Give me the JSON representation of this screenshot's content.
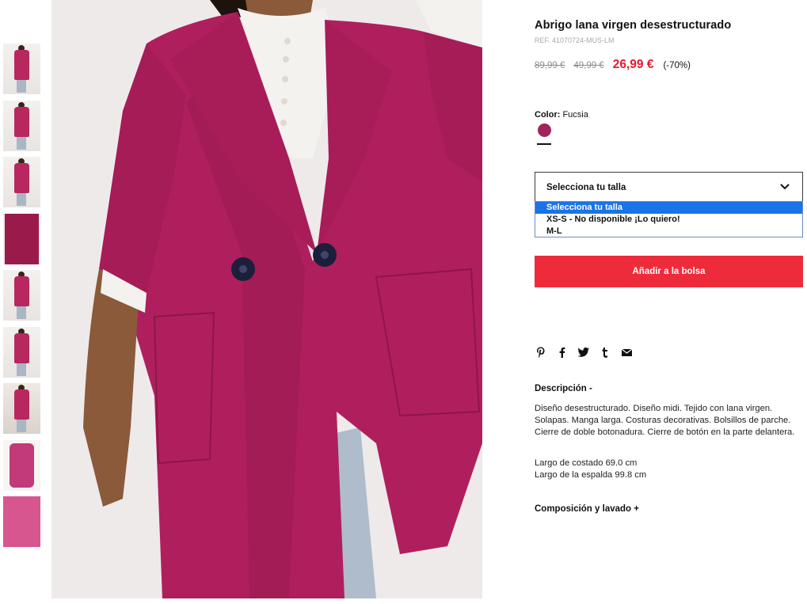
{
  "product": {
    "title": "Abrigo lana virgen desestructurado",
    "ref": "REF. 41070724-MUS-LM",
    "prices": {
      "original": "89,99 €",
      "previous": "49,99 €",
      "current": "26,99 €",
      "discount": "(-70%)"
    },
    "color": {
      "label": "Color:",
      "value": "Fucsia",
      "swatch_hex": "#a3225c"
    }
  },
  "size_select": {
    "placeholder": "Selecciona tu talla",
    "options": [
      "Selecciona tu talla",
      "XS-S - No disponible ¡Lo quiero!",
      "M-L"
    ],
    "highlighted": "Selecciona tu talla"
  },
  "add_to_bag": "Añadir a la bolsa",
  "share_icons": [
    "pinterest-icon",
    "facebook-icon",
    "twitter-icon",
    "tumblr-icon",
    "email-icon"
  ],
  "description": {
    "heading": "Descripción -",
    "text": "Diseño desestructurado. Diseño midi. Tejido con lana virgen. Solapas. Manga larga. Costuras decorativas. Bolsillos de parche. Cierre de doble botonadura. Cierre de botón en la parte delantera.",
    "measure_1": "Largo de costado 69.0 cm",
    "measure_2": "Largo de la espalda 99.8 cm"
  },
  "composition_heading": "Composición y lavado +",
  "colors": {
    "accent_red": "#ee2b3b",
    "price_red": "#e6192f",
    "dropdown_highlight": "#1a73e8"
  }
}
